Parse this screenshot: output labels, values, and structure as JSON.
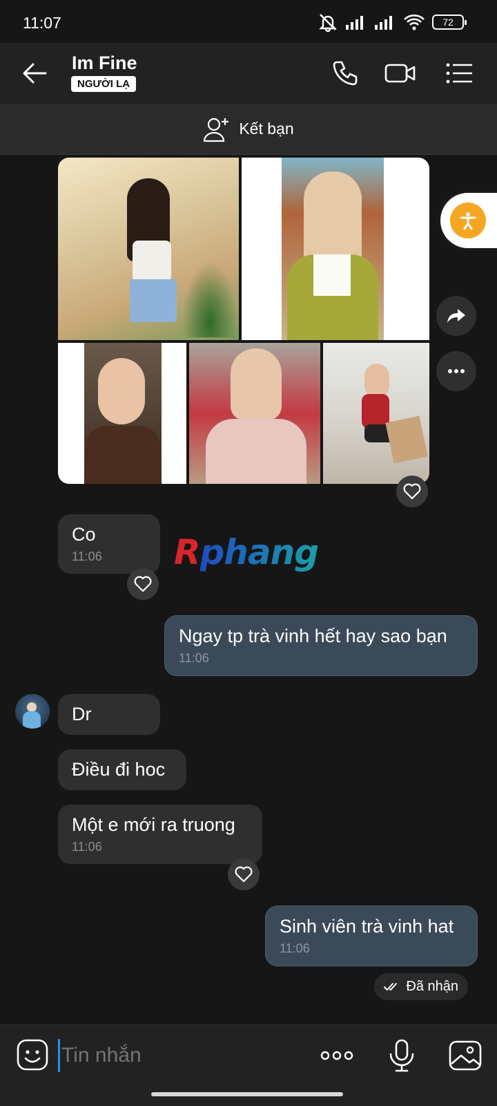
{
  "status_bar": {
    "time": "11:07",
    "battery": "72"
  },
  "header": {
    "title": "Im Fine",
    "badge": "NGƯỜI LẠ"
  },
  "add_friend": {
    "label": "Kết bạn"
  },
  "messages": [
    {
      "id": "m1",
      "direction": "in",
      "text": "Co",
      "time": "11:06"
    },
    {
      "id": "m2",
      "direction": "out",
      "text": "Ngay tp trà vinh hết hay sao bạn",
      "time": "11:06"
    },
    {
      "id": "m3",
      "direction": "in",
      "text": "Dr"
    },
    {
      "id": "m4",
      "direction": "in",
      "text": "Điều đi hoc"
    },
    {
      "id": "m5",
      "direction": "in",
      "text": "Một e mới ra truong",
      "time": "11:06"
    },
    {
      "id": "m6",
      "direction": "out",
      "text": "Sinh viên trà vinh hat",
      "time": "11:06"
    }
  ],
  "watermark": {
    "first": "R",
    "rest": "phang"
  },
  "delivery_status": "Đã nhận",
  "composer": {
    "placeholder": "Tin nhắn"
  },
  "colors": {
    "accent": "#2e8cf0",
    "outgoing_bubble": "#3b4a58",
    "incoming_bubble": "#2f2f2f"
  }
}
